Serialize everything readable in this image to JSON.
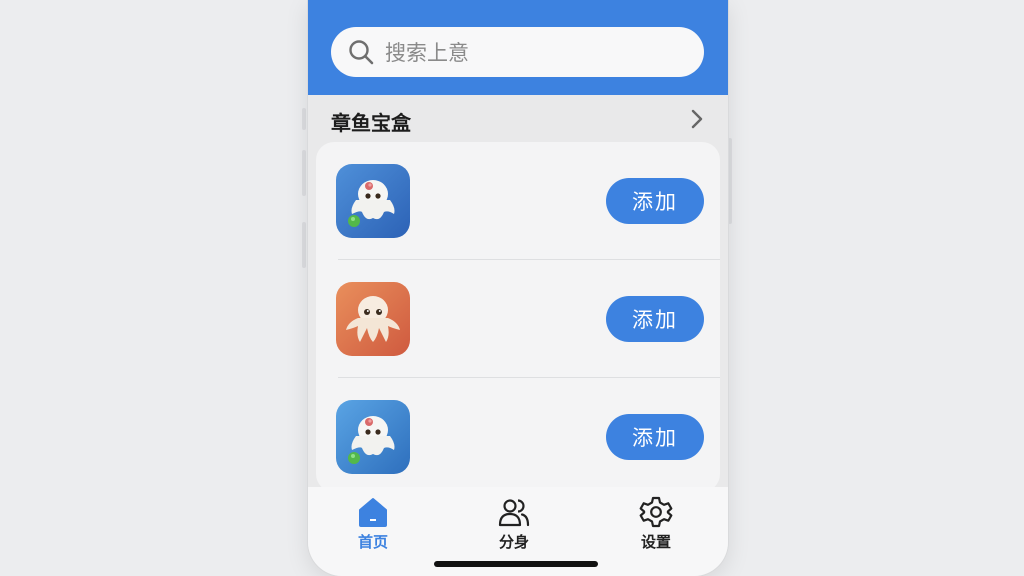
{
  "colors": {
    "accent": "#3d82e0",
    "header_bg": "#3d82e0",
    "page_bg": "#ecedef"
  },
  "search": {
    "placeholder": "搜索上意",
    "icon": "search-icon"
  },
  "section": {
    "title": "章鱼宝盒",
    "chevron": "chevron-right-icon"
  },
  "apps": [
    {
      "icon": "ghost-octopus-blue-app-icon",
      "button_label": "添加"
    },
    {
      "icon": "octopus-orange-app-icon",
      "button_label": "添加"
    },
    {
      "icon": "ghost-octopus-light-blue-app-icon",
      "button_label": "添加"
    }
  ],
  "tabs": [
    {
      "label": "首页",
      "icon": "home-icon",
      "active": true
    },
    {
      "label": "分身",
      "icon": "users-icon",
      "active": false
    },
    {
      "label": "设置",
      "icon": "gear-icon",
      "active": false
    }
  ]
}
